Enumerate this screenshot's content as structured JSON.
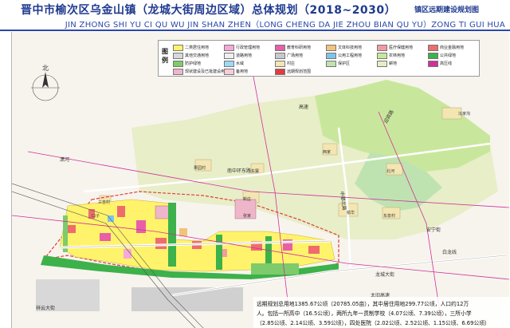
{
  "header": {
    "title": "晋中市榆次区乌金山镇（龙城大街周边区域）总体规划（2018~2030）",
    "subtitle": "镇区远期建设规划图",
    "pinyin": "JIN ZHONG SHI YU CI QU WU JIN SHAN ZHEN（LONG CHENG DA JIE ZHOU BIAN QU YU）ZONG TI GUI HUA"
  },
  "legend": {
    "title": "图例",
    "items": [
      {
        "label": "二类居住用地",
        "color": "#fff36b"
      },
      {
        "label": "行政管理用地",
        "color": "#f7a8d8"
      },
      {
        "label": "教育科研用地",
        "color": "#e95ea8"
      },
      {
        "label": "文体科技用地",
        "color": "#f3c27b"
      },
      {
        "label": "医疗保健用地",
        "color": "#f29aa4"
      },
      {
        "label": "商业金融用地",
        "color": "#ef6c6c"
      },
      {
        "label": "其他交通用地",
        "color": "#d8d8d8"
      },
      {
        "label": "道路用地",
        "color": "#eeeeee"
      },
      {
        "label": "广场用地",
        "color": "#c9c9c9"
      },
      {
        "label": "公用工程用地",
        "color": "#7cc4e8"
      },
      {
        "label": "农林用地",
        "color": "#c9e79c"
      },
      {
        "label": "公共绿地",
        "color": "#3db14a"
      },
      {
        "label": "防护绿地",
        "color": "#7ecb6b"
      },
      {
        "label": "水域",
        "color": "#9ed8f2"
      },
      {
        "label": "村庄",
        "color": "#f3e6b3"
      },
      {
        "label": "保护区",
        "color": "#bfe3b0"
      },
      {
        "label": "耕地",
        "color": "#e6edc3"
      },
      {
        "label": "高压线",
        "color": "#d0309a"
      },
      {
        "label": "现状建设及已批建设用地",
        "color": "#efb6c9"
      },
      {
        "label": "备用地",
        "color": "#f8ccd8"
      },
      {
        "label": "远期规划范围",
        "color": "#e23b3b"
      }
    ]
  },
  "map": {
    "labels": {
      "north": "北",
      "road_huancheng_east": "南中环东路",
      "road_longcheng": "龙城大街",
      "road_anning": "安宁街",
      "road_baiyi": "白龙线",
      "road_zhongdu": "中都北路",
      "road_yingbin": "迎宾路",
      "road_taijiu": "太旧高速",
      "road_xiangyun": "祥云大街",
      "road_gaosu": "高速",
      "river_xiaohe": "潇河",
      "village_fengjiayan": "冯家沟",
      "village_guoyuan": "果园村",
      "village_dongzhai": "东寨",
      "village_xijia": "西家",
      "village_beihe": "北河",
      "village_yuhua": "榆华",
      "village_dongquan": "东泉村",
      "village_xinzhuang": "新庄",
      "village_sanji": "三吉村",
      "village_zhangjia": "张家",
      "village_kouzi": "口子"
    }
  },
  "notes": {
    "line1": "远期规划总用地1385.67公顷（20785.05亩），其中居住用地299.77公顷，人口约12万",
    "line2": "人。包括一所高中（16.5公顷），两所九年一贯制学校（4.07公顷、7.39公顷），三所小学",
    "line3": "（2.85公顷、2.14公顷、3.59公顷），四处医院（2.02公顷、2.52公顷、1.15公顷、6.69公顷）"
  }
}
